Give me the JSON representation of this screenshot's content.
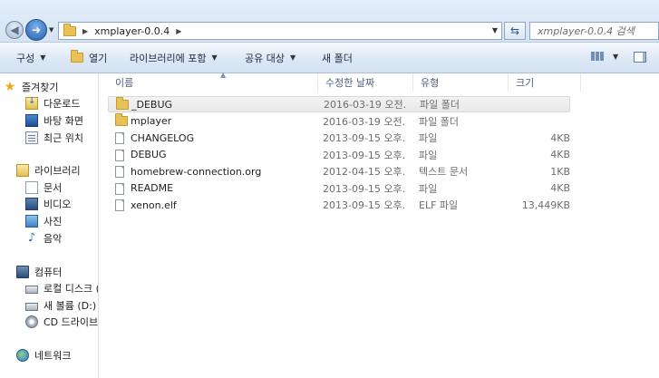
{
  "address": {
    "path_segment": "xmplayer-0.0.4",
    "search_placeholder": "xmplayer-0.0.4 검색"
  },
  "toolbar": {
    "organize": "구성",
    "open": "열기",
    "include_library": "라이브러리에 포함",
    "share": "공유 대상",
    "new_folder": "새 폴더"
  },
  "nav": {
    "favorites": "즐겨찾기",
    "downloads": "다운로드",
    "desktop": "바탕 화면",
    "recent": "최근 위치",
    "libraries": "라이브러리",
    "documents": "문서",
    "videos": "비디오",
    "pictures": "사진",
    "music": "음악",
    "computer": "컴퓨터",
    "local_disk": "로컬 디스크 (",
    "new_volume": "새 볼륨 (D:)",
    "cd_drive": "CD 드라이브",
    "network": "네트워크"
  },
  "columns": {
    "name": "이름",
    "date": "수정한 날짜",
    "type": "유형",
    "size": "크기"
  },
  "files": [
    {
      "name": "_DEBUG",
      "date": "2016-03-19 오전...",
      "type": "파일 폴더",
      "size": "",
      "kind": "folder"
    },
    {
      "name": "mplayer",
      "date": "2016-03-19 오전...",
      "type": "파일 폴더",
      "size": "",
      "kind": "folder"
    },
    {
      "name": "CHANGELOG",
      "date": "2013-09-15 오후...",
      "type": "파일",
      "size": "4KB",
      "kind": "file"
    },
    {
      "name": "DEBUG",
      "date": "2013-09-15 오후...",
      "type": "파일",
      "size": "4KB",
      "kind": "file"
    },
    {
      "name": "homebrew-connection.org",
      "date": "2012-04-15 오후...",
      "type": "텍스트 문서",
      "size": "1KB",
      "kind": "file"
    },
    {
      "name": "README",
      "date": "2013-09-15 오후...",
      "type": "파일",
      "size": "4KB",
      "kind": "file"
    },
    {
      "name": "xenon.elf",
      "date": "2013-09-15 오후...",
      "type": "ELF 파일",
      "size": "13,449KB",
      "kind": "file"
    }
  ]
}
